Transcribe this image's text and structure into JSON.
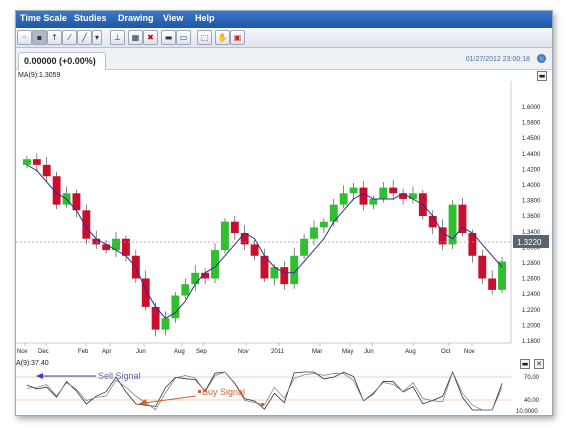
{
  "menu": [
    "Time Scale",
    "Studies",
    "Drawing",
    "View",
    "Help"
  ],
  "toolbar_icons": [
    "cursor-icon",
    "crosshair-icon",
    "arrow-up-icon",
    "arrow-tool-icon",
    "line-tool-icon",
    "dropdown-icon",
    "ruler-icon",
    "grid-icon",
    "delete-icon",
    "camera-icon",
    "print-icon",
    "fit-icon",
    "hand-icon",
    "save-icon"
  ],
  "tab": {
    "price_change": "0.00000 (+0.00%)"
  },
  "datetime": "01/27/2012 23:00:18",
  "main_chart": {
    "ma_label": "MA(9):1.3059",
    "current_price": "1.3220"
  },
  "indicator": {
    "label": "A(9):37.40",
    "sell_signal": "Sell Signal",
    "buy_signal": "Buy Signal",
    "ticks": [
      "70.00",
      "40.00",
      "10.0000"
    ]
  },
  "chart_data": {
    "type": "line",
    "title": "",
    "xlabel": "",
    "ylabel": "",
    "ylim": [
      1.18,
      1.62
    ],
    "y_ticks": [
      "1.6000",
      "1.5800",
      "1.4500",
      "1.4400",
      "1.4200",
      "1.4000",
      "1.3800",
      "1.3600",
      "1.3400",
      "1.3000",
      "1.2800",
      "1.2600",
      "1.2400",
      "1.2200",
      "1.2000",
      "1.1800"
    ],
    "x_ticks": [
      "Nov",
      "Dec",
      "Feb",
      "Apr",
      "Jun",
      "Aug",
      "Sep",
      "Nov",
      "2011",
      "Mar",
      "May",
      "Jun",
      "Aug",
      "Oct",
      "Nov"
    ],
    "series": [
      {
        "name": "MA(9)",
        "values": [
          1.49,
          1.48,
          1.46,
          1.44,
          1.43,
          1.41,
          1.38,
          1.36,
          1.35,
          1.34,
          1.33,
          1.31,
          1.27,
          1.24,
          1.22,
          1.23,
          1.25,
          1.28,
          1.3,
          1.31,
          1.33,
          1.35,
          1.37,
          1.36,
          1.33,
          1.31,
          1.3,
          1.3,
          1.32,
          1.34,
          1.36,
          1.39,
          1.41,
          1.43,
          1.44,
          1.43,
          1.43,
          1.43,
          1.44,
          1.43,
          1.42,
          1.4,
          1.37,
          1.36,
          1.38,
          1.37,
          1.35,
          1.33,
          1.31
        ]
      }
    ],
    "closes": [
      1.5,
      1.49,
      1.47,
      1.42,
      1.44,
      1.41,
      1.36,
      1.35,
      1.34,
      1.36,
      1.33,
      1.29,
      1.24,
      1.2,
      1.22,
      1.26,
      1.28,
      1.3,
      1.29,
      1.34,
      1.39,
      1.37,
      1.35,
      1.33,
      1.29,
      1.31,
      1.28,
      1.33,
      1.36,
      1.38,
      1.39,
      1.42,
      1.44,
      1.45,
      1.42,
      1.43,
      1.45,
      1.44,
      1.43,
      1.44,
      1.4,
      1.38,
      1.35,
      1.42,
      1.37,
      1.33,
      1.29,
      1.27,
      1.32
    ]
  }
}
